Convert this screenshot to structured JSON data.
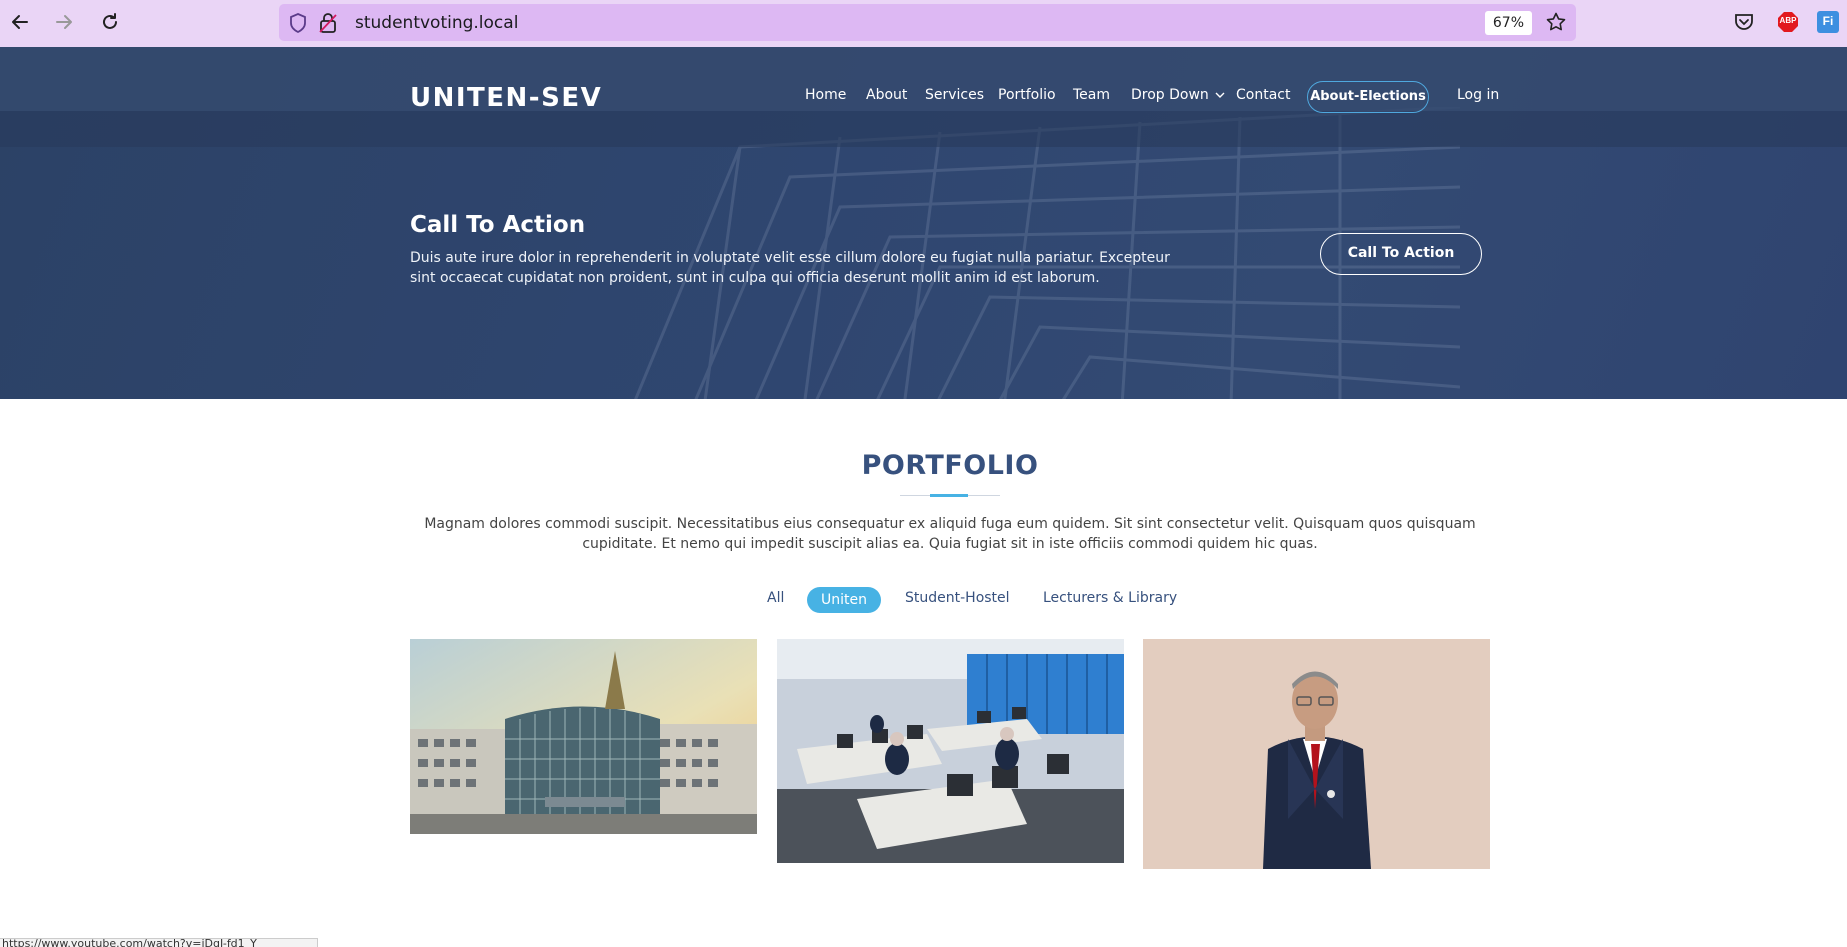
{
  "browser": {
    "url": "studentvoting.local",
    "zoom": "67%",
    "extensions": [
      "pocket-icon",
      "adblock-icon",
      "translate-icon"
    ],
    "adblock_label": "ABP",
    "translate_label": "Fi"
  },
  "header": {
    "logo": "UNITEN-SEV",
    "nav": [
      {
        "label": "Home"
      },
      {
        "label": "About"
      },
      {
        "label": "Services"
      },
      {
        "label": "Portfolio"
      },
      {
        "label": "Team"
      },
      {
        "label": "Drop Down"
      },
      {
        "label": "Contact"
      }
    ],
    "pill_label": "About-Elections",
    "login_label": "Log in"
  },
  "cta": {
    "title": "Call To Action",
    "text": "Duis aute irure dolor in reprehenderit in voluptate velit esse cillum dolore eu fugiat nulla pariatur. Excepteur sint occaecat cupidatat non proident, sunt in culpa qui officia deserunt mollit anim id est laborum.",
    "button_label": "Call To Action"
  },
  "portfolio": {
    "title": "PORTFOLIO",
    "text": "Magnam dolores commodi suscipit. Necessitatibus eius consequatur ex aliquid fuga eum quidem. Sit sint consectetur velit. Quisquam quos quisquam cupiditate. Et nemo qui impedit suscipit alias ea. Quia fugiat sit in iste officiis commodi quidem hic quas.",
    "filters": [
      {
        "label": "All"
      },
      {
        "label": "Uniten"
      },
      {
        "label": "Student-Hostel"
      },
      {
        "label": "Lecturers & Library"
      }
    ],
    "active_filter": "Uniten"
  },
  "status_bar": {
    "text": "https://www.youtube.com/watch?v=jDqJ-fd1_Y"
  },
  "colors": {
    "accent": "#47b2e4",
    "hero_bg": "#2f4670",
    "title": "#37517e"
  }
}
